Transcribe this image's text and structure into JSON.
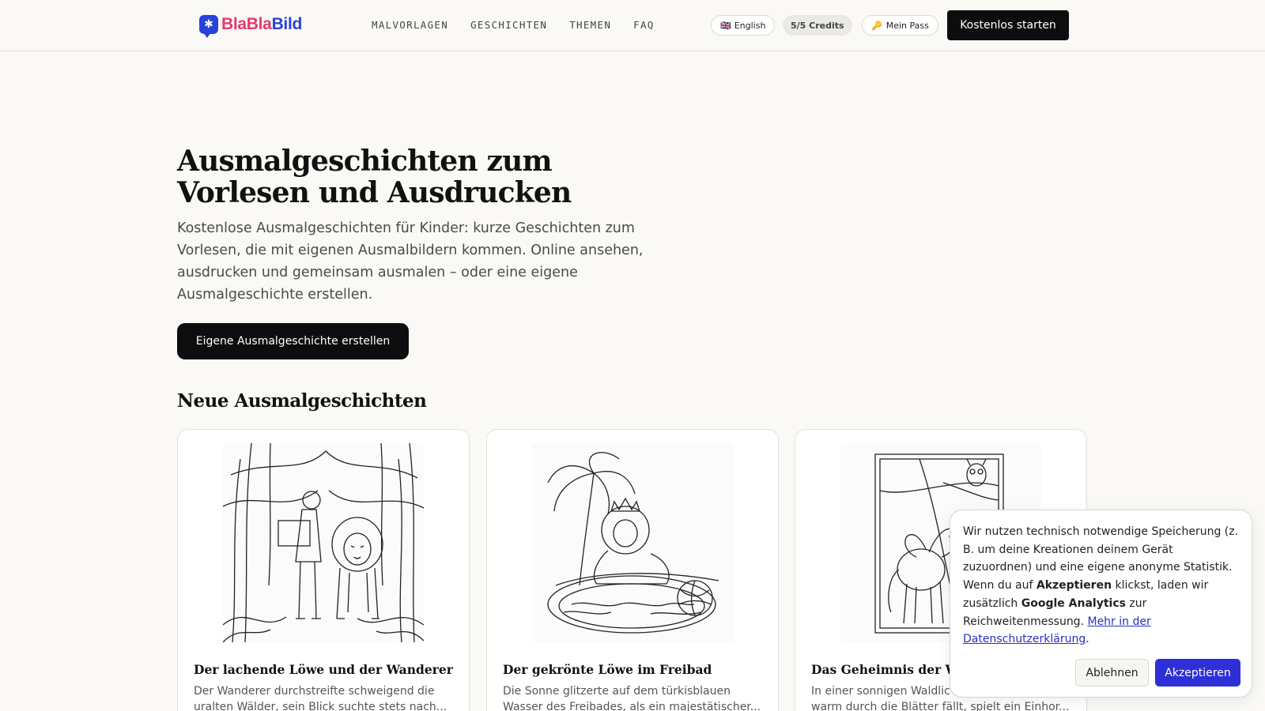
{
  "header": {
    "logo_icon": "asterisk-bubble-icon",
    "logo_text_part1": "Bla",
    "logo_text_part2": "Bla",
    "logo_text_part3": "Bild",
    "nav": [
      "MALVORLAGEN",
      "GESCHICHTEN",
      "THEMEN",
      "FAQ"
    ],
    "language_flag": "🇬🇧",
    "language_label": "English",
    "credits": "5/5 Credits",
    "pass_icon": "🔑",
    "pass_label": "Mein Pass",
    "cta_label": "Kostenlos starten"
  },
  "hero": {
    "title": "Ausmalgeschichten zum Vorlesen und Ausdrucken",
    "description": "Kostenlose Ausmalgeschichten für Kinder: kurze Geschichten zum Vorlesen, die mit eigenen Ausmalbildern kommen. Online ansehen, ausdrucken und gemeinsam ausmalen – oder eine eigene Ausmalgeschichte erstellen.",
    "button_label": "Eigene Ausmalgeschichte erstellen"
  },
  "section_title": "Neue Ausmalgeschichten",
  "cards": [
    {
      "title": "Der lachende Löwe und der Wanderer",
      "line1": "Der Wanderer durchstreifte schweigend die",
      "line2": "uralten Wälder, sein Blick suchte stets nach..."
    },
    {
      "title": "Der gekrönte Löwe im Freibad",
      "line1": "Die Sonne glitzerte auf dem türkisblauen",
      "line2": "Wasser des Freibades, als ein majestätischer..."
    },
    {
      "title": "Das Geheimnis der W",
      "line1": "In einer sonnigen Waldlic",
      "line2": "warm durch die Blätter fällt, spielt ein Einhor..."
    }
  ],
  "cookie": {
    "text_part1": "Wir nutzen technisch notwendige Speicherung (z. B. um deine Kreationen deinem Gerät zuzuordnen) und eine eigene anonyme Statistik. Wenn du auf ",
    "bold1": "Akzeptieren",
    "text_part2": " klickst, laden wir zusätzlich ",
    "bold2": "Google Analytics",
    "text_part3": " zur Reichweitenmessung. ",
    "link": "Mehr in der Datenschutzerklärung",
    "text_part4": ".",
    "decline_label": "Ablehnen",
    "accept_label": "Akzeptieren"
  }
}
